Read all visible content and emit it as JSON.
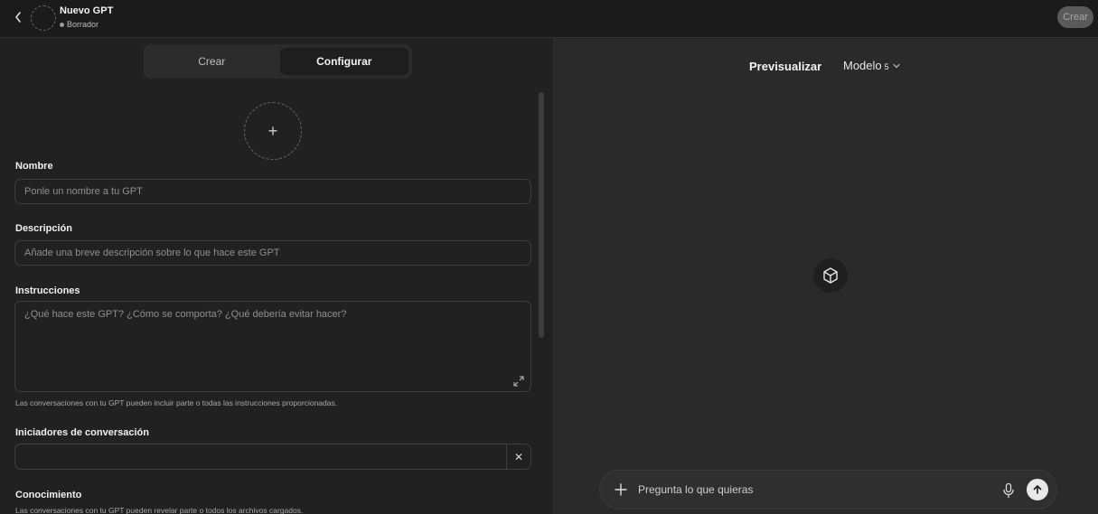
{
  "header": {
    "title": "Nuevo GPT",
    "status": "Borrador",
    "create_label": "Crear"
  },
  "tabs": [
    {
      "label": "Crear",
      "active": false
    },
    {
      "label": "Configurar",
      "active": true
    }
  ],
  "form": {
    "name": {
      "label": "Nombre",
      "placeholder": "Ponle un nombre a tu GPT",
      "value": ""
    },
    "description": {
      "label": "Descripción",
      "placeholder": "Añade una breve descripción sobre lo que hace este GPT",
      "value": ""
    },
    "instructions": {
      "label": "Instrucciones",
      "placeholder": "¿Qué hace este GPT? ¿Cómo se comporta? ¿Qué debería evitar hacer?",
      "value": "",
      "hint": "Las conversaciones con tu GPT pueden incluir parte o todas las instrucciones proporcionadas."
    },
    "starters": {
      "label": "Iniciadores de conversación",
      "value": "",
      "remove_label": "✕"
    },
    "knowledge": {
      "label": "Conocimiento",
      "hint": "Las conversaciones con tu GPT pueden revelar parte o todos los archivos cargados."
    }
  },
  "preview": {
    "title": "Previsualizar",
    "model_label": "Modelo",
    "model_version": "5",
    "composer_placeholder": "Pregunta lo que quieras"
  },
  "colors": {
    "background": "#212121",
    "preview_background": "#2a2a2a",
    "send_button": "#e8e8e8"
  }
}
